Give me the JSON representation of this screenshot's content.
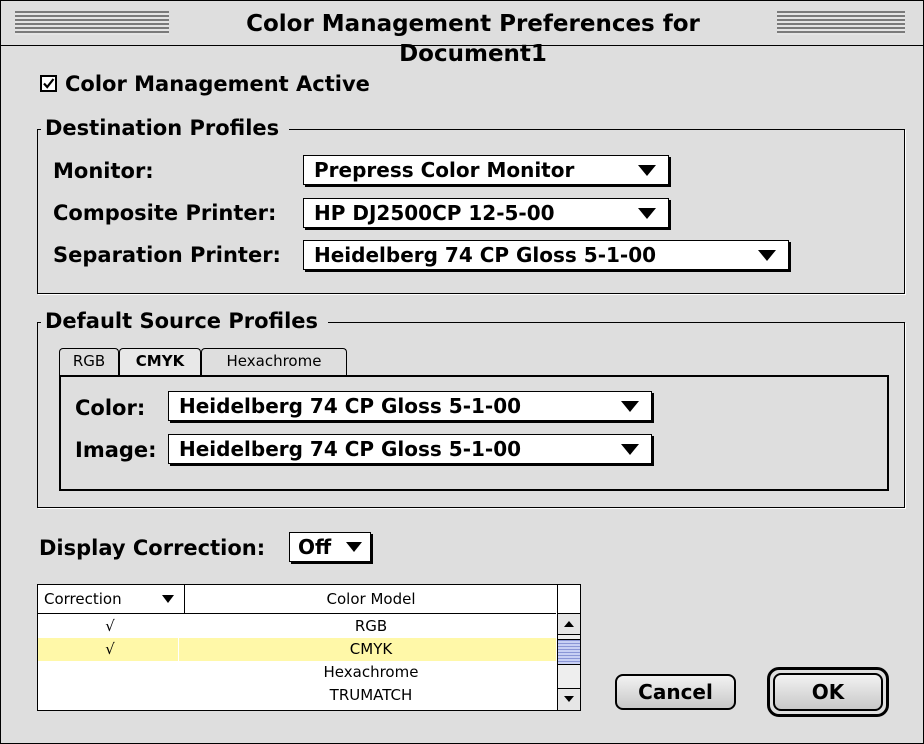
{
  "title": "Color Management Preferences for Document1",
  "color_management_active": {
    "label": "Color Management Active",
    "checked": true
  },
  "destination_profiles": {
    "title": "Destination Profiles",
    "monitor": {
      "label": "Monitor:",
      "value": "Prepress Color Monitor"
    },
    "composite_printer": {
      "label": "Composite Printer:",
      "value": "HP DJ2500CP 12-5-00"
    },
    "separation_printer": {
      "label": "Separation Printer:",
      "value": "Heidelberg 74 CP Gloss 5-1-00"
    }
  },
  "default_source_profiles": {
    "title": "Default Source Profiles",
    "tabs": [
      {
        "label": "RGB"
      },
      {
        "label": "CMYK",
        "active": true
      },
      {
        "label": "Hexachrome"
      }
    ],
    "color": {
      "label": "Color:",
      "value": "Heidelberg 74 CP Gloss 5-1-00"
    },
    "image": {
      "label": "Image:",
      "value": "Heidelberg 74 CP Gloss 5-1-00"
    }
  },
  "display_correction": {
    "label": "Display Correction:",
    "value": "Off"
  },
  "correction_table": {
    "headers": {
      "correction": "Correction",
      "color_model": "Color Model"
    },
    "rows": [
      {
        "check": "√",
        "model": "RGB"
      },
      {
        "check": "√",
        "model": "CMYK",
        "selected": true
      },
      {
        "check": "",
        "model": "Hexachrome"
      },
      {
        "check": "",
        "model": "TRUMATCH"
      }
    ]
  },
  "buttons": {
    "cancel": "Cancel",
    "ok": "OK"
  },
  "colors": {
    "dialog_bg": "#dedede",
    "selected_row": "#fff8a8"
  }
}
